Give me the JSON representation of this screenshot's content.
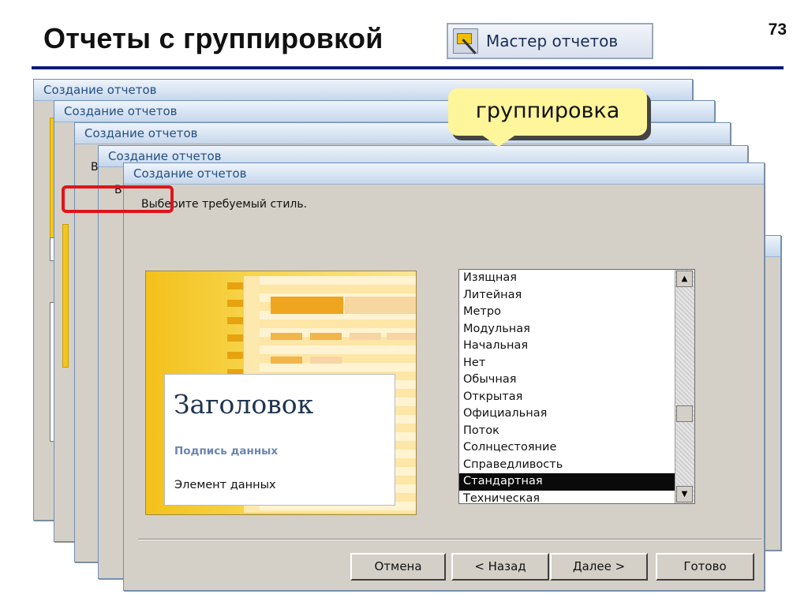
{
  "slide": {
    "title": "Отчеты с группировкой",
    "page_number": "73",
    "wizard_button_label": "Мастер отчетов",
    "callout_label": "группировка"
  },
  "dialog": {
    "title": "Создание отчетов",
    "instruction": "Выберите требуемый стиль.",
    "behind_letters": [
      "В",
      "В"
    ],
    "preview": {
      "heading": "Заголовок",
      "caption": "Подпись данных",
      "item": "Элемент данных"
    },
    "styles": [
      "Изящная",
      "Литейная",
      "Метро",
      "Модульная",
      "Начальная",
      "Нет",
      "Обычная",
      "Открытая",
      "Официальная",
      "Поток",
      "Солнцестояние",
      "Справедливость",
      "Стандартная",
      "Техническая"
    ],
    "selected_style": "Стандартная",
    "buttons": {
      "cancel": "Отмена",
      "back": "< Назад",
      "next": "Далее >",
      "finish": "Готово"
    }
  },
  "colors": {
    "accent_rule": "#0d1a7a",
    "highlight": "#e0141a",
    "callout": "#fff59a"
  }
}
